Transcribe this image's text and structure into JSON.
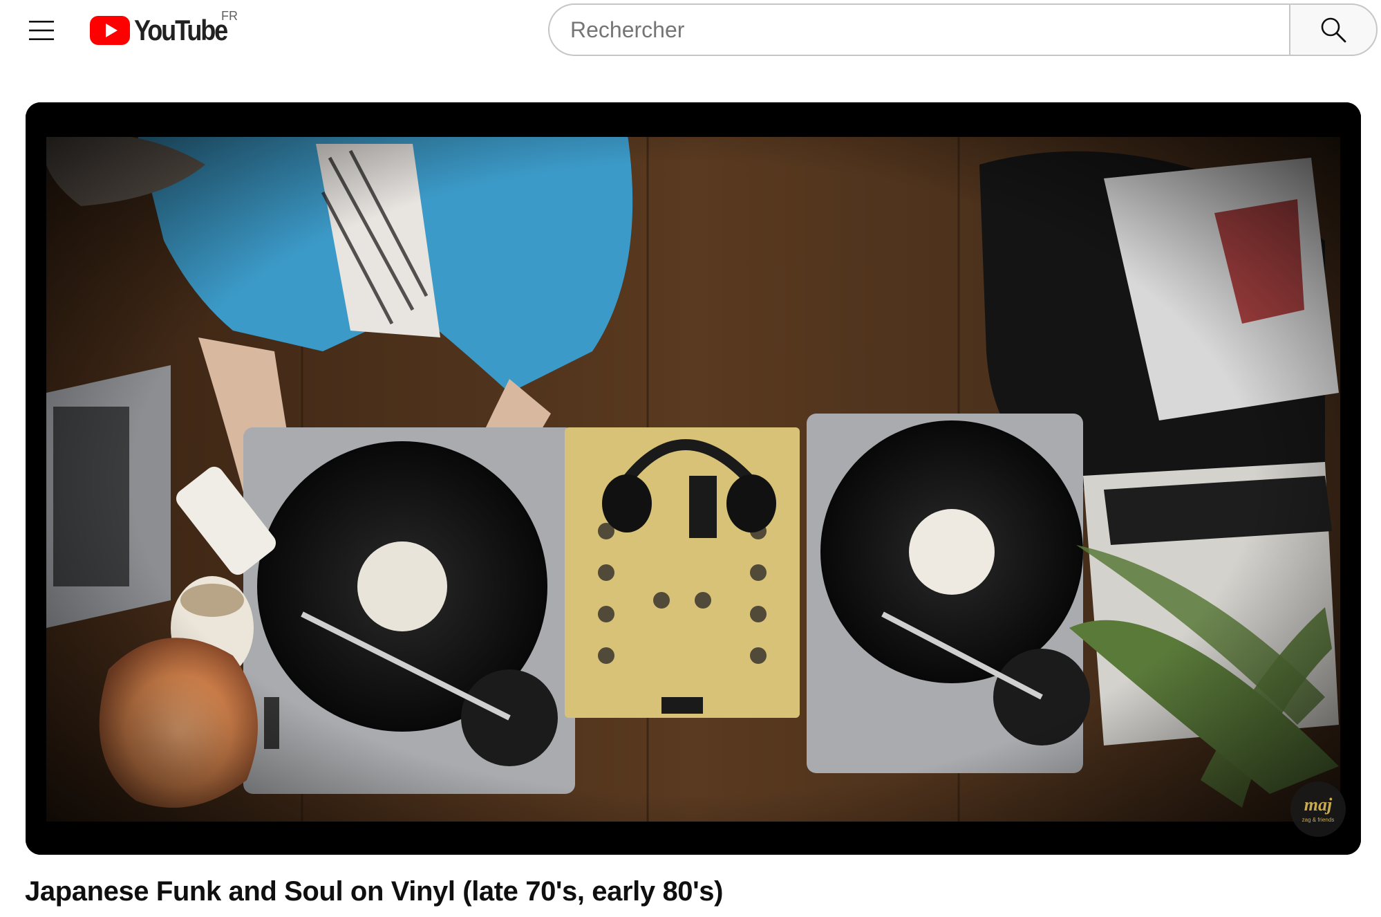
{
  "masthead": {
    "logo_text": "YouTube",
    "country_code": "FR",
    "search": {
      "placeholder": "Rechercher",
      "value": ""
    },
    "icons": {
      "menu": "hamburger-menu-icon",
      "logo": "youtube-play-icon",
      "search": "search-icon"
    }
  },
  "player": {
    "watermark_text": "maj",
    "watermark_subtext": "zag & friends"
  },
  "video": {
    "title": "Japanese Funk and Soul on Vinyl (late 70's, early 80's)"
  },
  "colors": {
    "brand_red": "#FF0000",
    "text_primary": "#0F0F0F",
    "search_border": "#C6C6C6",
    "search_button_bg": "#F8F8F8"
  }
}
